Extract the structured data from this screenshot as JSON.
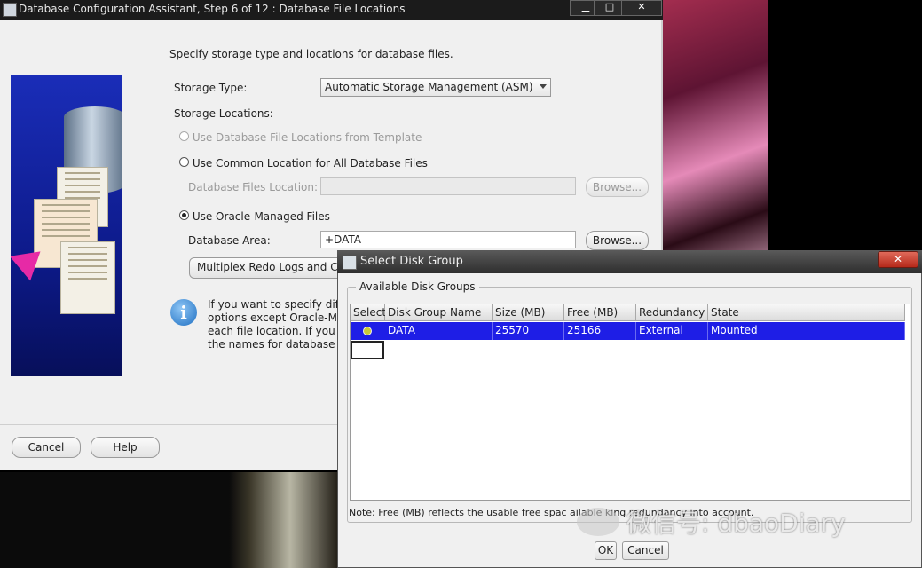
{
  "main_window": {
    "title": "Database Configuration Assistant, Step 6 of 12 : Database File Locations",
    "controls": {
      "minimize": "▁",
      "maximize": "□",
      "close": "✕"
    },
    "instruction": "Specify storage type and locations for database files.",
    "storage_type_label": "Storage Type:",
    "storage_type_value": "Automatic Storage Management (ASM)",
    "storage_locations_label": "Storage Locations:",
    "option_template": "Use Database File Locations from Template",
    "option_common": "Use Common Location for All Database Files",
    "db_files_location_label": "Database Files Location:",
    "db_files_location_value": "",
    "browse_label": "Browse...",
    "option_omf": "Use Oracle-Managed Files",
    "db_area_label": "Database Area:",
    "db_area_value": "+DATA",
    "multiplex_label": "Multiplex Redo Logs and C",
    "info_lines": [
      "If you want to specify diff",
      "options except Oracle-M",
      "each file location. If you u",
      "the names for database"
    ],
    "cancel_label": "Cancel",
    "help_label": "Help"
  },
  "dialog": {
    "title": "Select Disk Group",
    "close_label": "✕",
    "group_label": "Available Disk Groups",
    "columns": [
      "Select",
      "Disk Group Name",
      "Size (MB)",
      "Free (MB)",
      "Redundancy",
      "State"
    ],
    "rows": [
      {
        "name": "DATA",
        "size": "25570",
        "free": "25166",
        "redundancy": "External",
        "state": "Mounted"
      }
    ],
    "note": "Note:  Free (MB) reflects the usable free spac   ailable   king redundancy into account.",
    "ok_label": "OK",
    "cancel_label": "Cancel"
  },
  "watermark": "微信号: dbaoDiary"
}
